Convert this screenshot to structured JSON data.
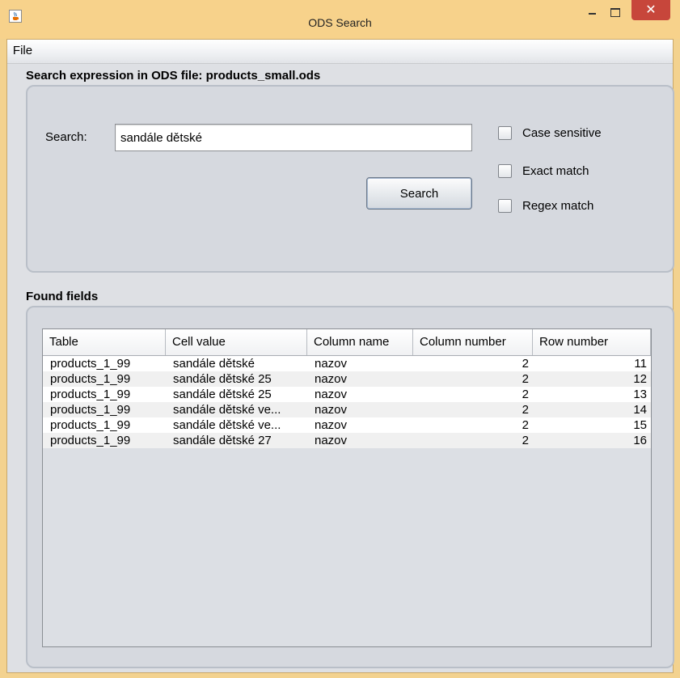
{
  "window": {
    "title": "ODS Search"
  },
  "menu": {
    "file": "File"
  },
  "search_section": {
    "title": "Search expression in ODS file: products_small.ods",
    "search_label": "Search:",
    "search_value": "sandále dětské",
    "search_button": "Search",
    "options": [
      {
        "label": "Case sensitive",
        "checked": false
      },
      {
        "label": "Exact match",
        "checked": false
      },
      {
        "label": "Regex match",
        "checked": false
      }
    ]
  },
  "results_section": {
    "title": "Found fields",
    "columns": [
      "Table",
      "Cell value",
      "Column name",
      "Column number",
      "Row number"
    ],
    "rows": [
      [
        "products_1_99",
        "sandále dětské",
        "nazov",
        "2",
        "11"
      ],
      [
        "products_1_99",
        "sandále dětské 25",
        "nazov",
        "2",
        "12"
      ],
      [
        "products_1_99",
        "sandále dětské 25",
        "nazov",
        "2",
        "13"
      ],
      [
        "products_1_99",
        "sandále dětské ve...",
        "nazov",
        "2",
        "14"
      ],
      [
        "products_1_99",
        "sandále dětské ve...",
        "nazov",
        "2",
        "15"
      ],
      [
        "products_1_99",
        "sandále dětské 27",
        "nazov",
        "2",
        "16"
      ]
    ]
  },
  "icons": {
    "app": "java-cup-icon",
    "minimize": "minimize-icon",
    "maximize": "maximize-icon",
    "close": "close-icon"
  },
  "colors": {
    "titlebar": "#f7d28b",
    "close_button": "#c7463b",
    "panel_background": "#d6d9df"
  }
}
